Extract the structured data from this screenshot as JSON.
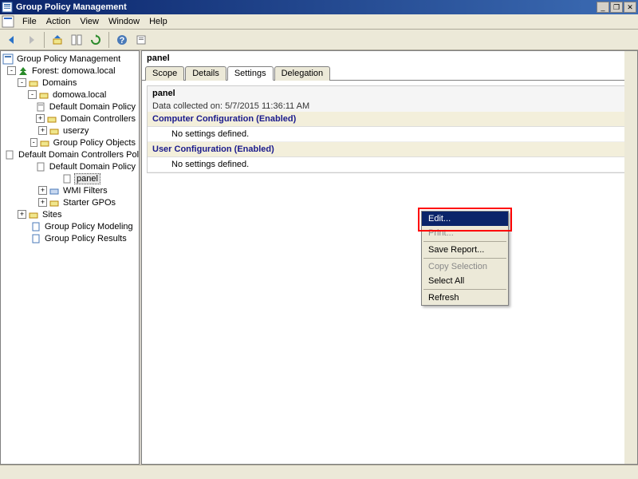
{
  "title": "Group Policy Management",
  "window_buttons": {
    "min": "_",
    "restore": "❐",
    "close": "✕"
  },
  "menu": [
    "File",
    "Action",
    "View",
    "Window",
    "Help"
  ],
  "tree": {
    "root": "Group Policy Management",
    "forest": "Forest: domowa.local",
    "domains": "Domains",
    "domain": "domowa.local",
    "items": [
      "Default Domain Policy",
      "Domain Controllers",
      "userzy",
      "Group Policy Objects"
    ],
    "gpo_items": [
      "Default Domain Controllers Polic",
      "Default Domain Policy",
      "panel"
    ],
    "wmi": "WMI Filters",
    "starter": "Starter GPOs",
    "sites": "Sites",
    "modeling": "Group Policy Modeling",
    "results": "Group Policy Results"
  },
  "detail": {
    "title": "panel",
    "tabs": [
      "Scope",
      "Details",
      "Settings",
      "Delegation"
    ],
    "active_tab": 2,
    "section_title": "panel",
    "section_subtitle": "Data collected on: 5/7/2015 11:36:11 AM",
    "comp_config": "Computer Configuration (Enabled)",
    "user_config": "User Configuration (Enabled)",
    "no_settings": "No settings defined."
  },
  "context": {
    "edit": "Edit...",
    "print": "Print...",
    "save": "Save Report...",
    "copy": "Copy Selection",
    "select": "Select All",
    "refresh": "Refresh"
  }
}
